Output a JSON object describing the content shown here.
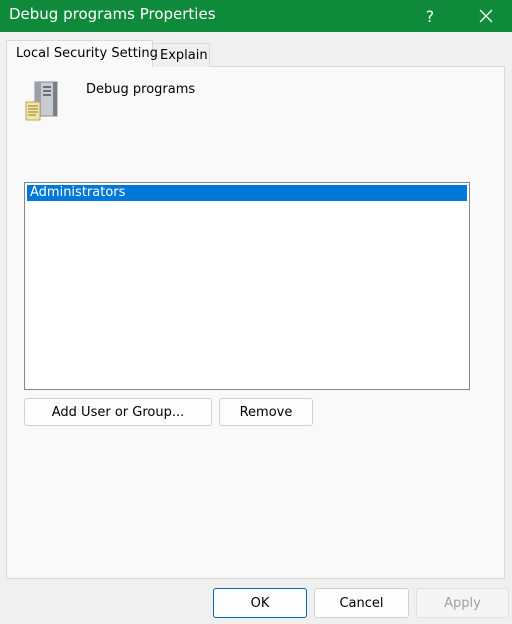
{
  "window": {
    "title": "Debug programs Properties",
    "help_label": "?",
    "close_label": "✕",
    "accent_color": "#0e8a3a"
  },
  "tabs": [
    {
      "label": "Local Security Setting",
      "active": true
    },
    {
      "label": "Explain",
      "active": false
    }
  ],
  "policy": {
    "name": "Debug programs",
    "icon": "server-icon"
  },
  "list": {
    "items": [
      {
        "label": "Administrators",
        "selected": true
      }
    ],
    "selection_color": "#0078d7"
  },
  "actions": {
    "add_label": "Add User or Group...",
    "remove_label": "Remove"
  },
  "footer": {
    "ok_label": "OK",
    "cancel_label": "Cancel",
    "apply_label": "Apply",
    "apply_enabled": false
  }
}
